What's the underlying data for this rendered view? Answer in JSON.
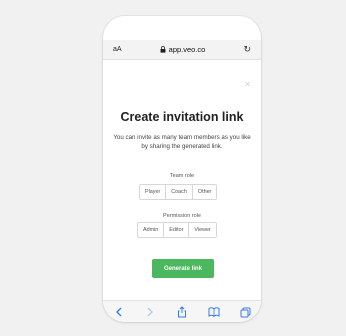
{
  "browser": {
    "aa_label": "aA",
    "url": "app.veo.co"
  },
  "dialog": {
    "title": "Create invitation link",
    "description": "You can invite as many team members as you like by sharing the generated link.",
    "team_role": {
      "label": "Team role",
      "options": [
        "Player",
        "Coach",
        "Other"
      ]
    },
    "permission_role": {
      "label": "Permission role",
      "options": [
        "Admin",
        "Editor",
        "Viewer"
      ]
    },
    "generate_label": "Generate link"
  },
  "icons": {
    "close": "close-icon",
    "lock": "lock-icon",
    "reload": "reload-icon",
    "back": "back-chevron-icon",
    "forward": "forward-chevron-icon",
    "share": "share-icon",
    "bookmarks": "book-icon",
    "tabs": "tabs-icon"
  },
  "colors": {
    "accent": "#4bb75e",
    "toolbar_icon_active": "#3478f6",
    "toolbar_icon_disabled": "#b7c8e8"
  }
}
